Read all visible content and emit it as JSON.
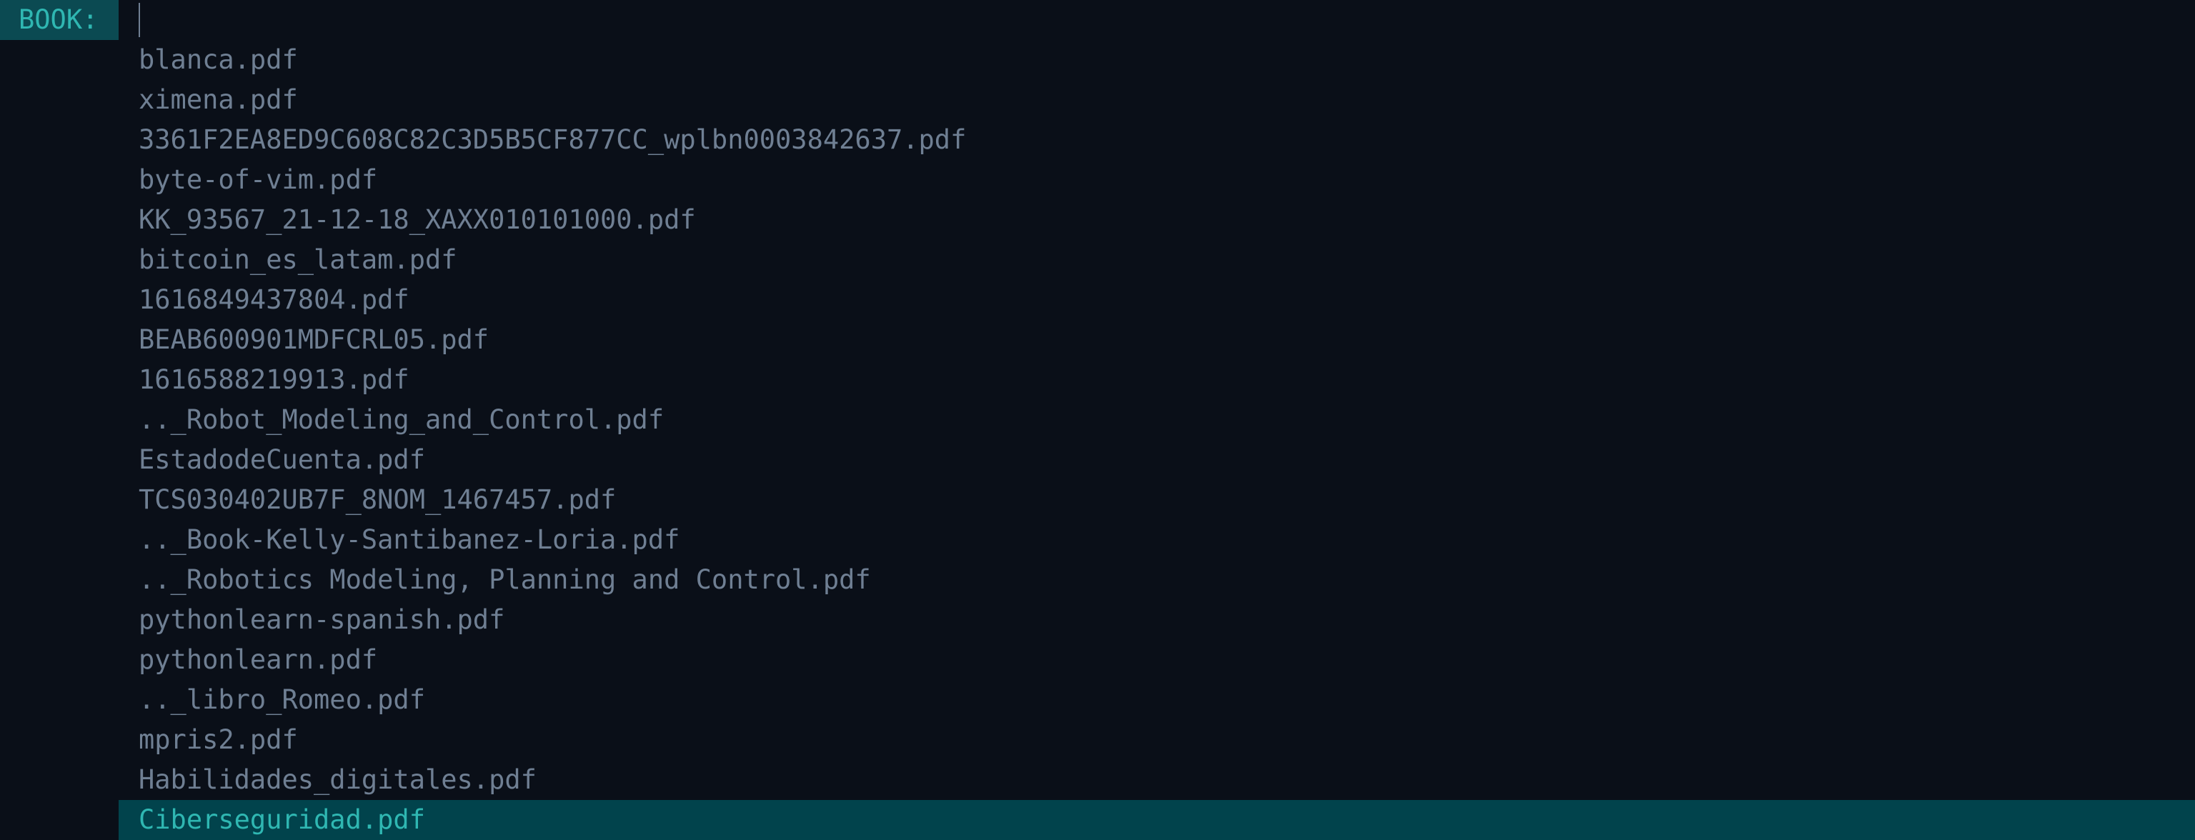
{
  "prompt": {
    "label": "BOOK:",
    "value": ""
  },
  "items": [
    "blanca.pdf",
    "ximena.pdf",
    "3361F2EA8ED9C608C82C3D5B5CF877CC_wplbn0003842637.pdf",
    "byte-of-vim.pdf",
    "KK_93567_21-12-18_XAXX010101000.pdf",
    "bitcoin_es_latam.pdf",
    "1616849437804.pdf",
    "BEAB600901MDFCRL05.pdf",
    "1616588219913.pdf",
    ".._Robot_Modeling_and_Control.pdf",
    "EstadodeCuenta.pdf",
    "TCS030402UB7F_8NOM_1467457.pdf",
    ".._Book-Kelly-Santibanez-Loria.pdf",
    ".._Robotics Modeling, Planning and Control.pdf",
    "pythonlearn-spanish.pdf",
    "pythonlearn.pdf",
    ".._libro_Romeo.pdf",
    "mpris2.pdf",
    "Habilidades_digitales.pdf",
    "Ciberseguridad.pdf"
  ],
  "selected_index": 19,
  "colors": {
    "background": "#0a0f18",
    "text": "#6f7f93",
    "accent_text": "#2fb7b2",
    "label_bg": "#0b4a52",
    "selected_bg": "#01434c"
  }
}
